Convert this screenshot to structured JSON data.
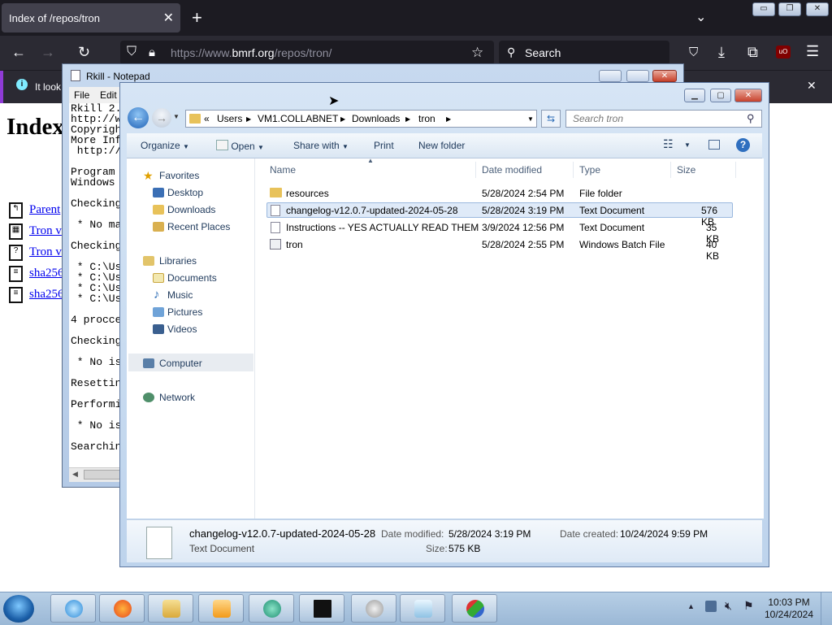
{
  "browser": {
    "tab_title": "Index of /repos/tron",
    "url_prefix": "https://www.",
    "url_domain": "bmrf.org",
    "url_path": "/repos/tron/",
    "search_placeholder": "Search",
    "info_text": "It look",
    "page_heading": "Index",
    "page_links": [
      "Parent",
      "Tron v",
      "Tron v",
      "sha256",
      "sha256"
    ],
    "accent_color": "#8f3bd6"
  },
  "notepad": {
    "title": "Rkill - Notepad",
    "menu": [
      "File",
      "Edit"
    ],
    "lines": [
      "Rkill 2.",
      "http://w",
      "Copyrigh",
      "More Inf",
      " http://",
      "",
      "Program ",
      "Windows ",
      "",
      "Checking",
      "",
      " * No ma",
      "",
      "Checking",
      "",
      " * C:\\Us",
      " * C:\\Us",
      " * C:\\Us",
      " * C:\\Us",
      "",
      "4 procce",
      "",
      "Checking",
      "",
      " * No is",
      "",
      "Resettin",
      "",
      "Performi",
      "",
      " * No is",
      "",
      "Searchin"
    ]
  },
  "explorer": {
    "breadcrumb": [
      "Users",
      "VM1.COLLABNET",
      "Downloads",
      "tron"
    ],
    "breadcrumb_prefix": "«",
    "search_placeholder": "Search tron",
    "toolbar": {
      "organize": "Organize",
      "open": "Open",
      "share_with": "Share with",
      "print": "Print",
      "new_folder": "New folder"
    },
    "nav": {
      "favorites": "Favorites",
      "favorites_items": [
        "Desktop",
        "Downloads",
        "Recent Places"
      ],
      "libraries": "Libraries",
      "libraries_items": [
        "Documents",
        "Music",
        "Pictures",
        "Videos"
      ],
      "computer": "Computer",
      "network": "Network"
    },
    "columns": {
      "name": "Name",
      "date": "Date modified",
      "type": "Type",
      "size": "Size"
    },
    "files": [
      {
        "name": "resources",
        "date": "5/28/2024 2:54 PM",
        "type": "File folder",
        "size": "",
        "icon": "folder-icon"
      },
      {
        "name": "changelog-v12.0.7-updated-2024-05-28",
        "date": "5/28/2024 3:19 PM",
        "type": "Text Document",
        "size": "576 KB",
        "icon": "text-file-icon",
        "selected": true
      },
      {
        "name": "Instructions -- YES ACTUALLY READ THEM",
        "date": "3/9/2024 12:56 PM",
        "type": "Text Document",
        "size": "35 KB",
        "icon": "text-file-icon"
      },
      {
        "name": "tron",
        "date": "5/28/2024 2:55 PM",
        "type": "Windows Batch File",
        "size": "40 KB",
        "icon": "batch-file-icon"
      }
    ],
    "details": {
      "name": "changelog-v12.0.7-updated-2024-05-28",
      "type": "Text Document",
      "modified_label": "Date modified:",
      "modified_value": "5/28/2024 3:19 PM",
      "size_label": "Size:",
      "size_value": "575 KB",
      "created_label": "Date created:",
      "created_value": "10/24/2024 9:59 PM"
    }
  },
  "taskbar": {
    "time": "10:03 PM",
    "date": "10/24/2024"
  }
}
